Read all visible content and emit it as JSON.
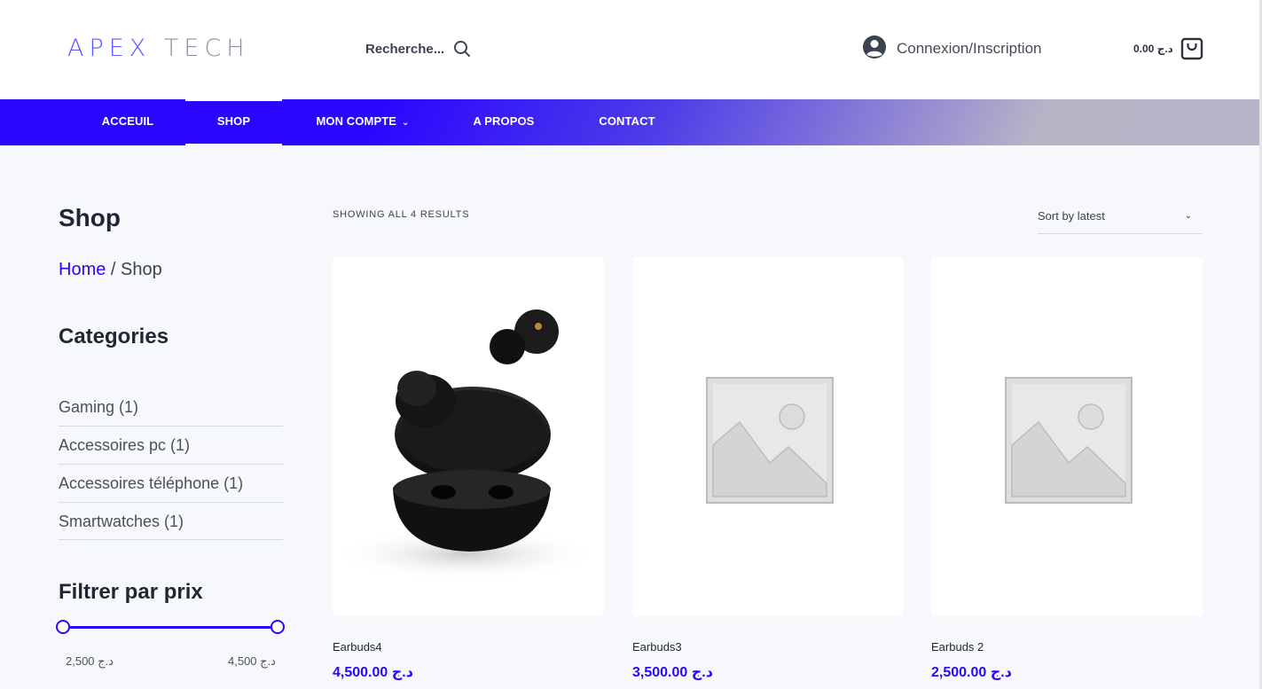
{
  "header": {
    "logo_main": "APEX",
    "logo_accent": "TECH",
    "search_label": "Recherche...",
    "account_label": "Connexion/Inscription",
    "cart_total": "0.00 د.ج"
  },
  "nav": {
    "items": [
      {
        "label": "ACCEUIL"
      },
      {
        "label": "SHOP"
      },
      {
        "label": "MON COMPTE"
      },
      {
        "label": "A PROPOS"
      },
      {
        "label": "CONTACT"
      }
    ],
    "active": "SHOP"
  },
  "sidebar": {
    "page_title": "Shop",
    "breadcrumb": {
      "home": "Home",
      "separator": " / ",
      "current": "Shop"
    },
    "categories_title": "Categories",
    "categories": [
      {
        "label": "Gaming (1)"
      },
      {
        "label": "Accessoires pc (1)"
      },
      {
        "label": "Accessoires téléphone (1)"
      },
      {
        "label": "Smartwatches (1)"
      }
    ],
    "filter_title": "Filtrer par prix",
    "price_min": "2,500 د.ج",
    "price_max": "4,500 د.ج"
  },
  "main": {
    "results_text": "SHOWING ALL 4 RESULTS",
    "sort_label": "Sort by latest",
    "products": [
      {
        "name": "Earbuds4",
        "price": "4,500.00 د.ج",
        "image": "earbuds-photo"
      },
      {
        "name": "Earbuds3",
        "price": "3,500.00 د.ج",
        "image": "placeholder-image"
      },
      {
        "name": "Earbuds 2",
        "price": "2,500.00 د.ج",
        "image": "placeholder-image"
      }
    ]
  },
  "colors": {
    "accent": "#2a06ff",
    "text_dark": "#1f2733",
    "background": "#f7f8fb"
  }
}
